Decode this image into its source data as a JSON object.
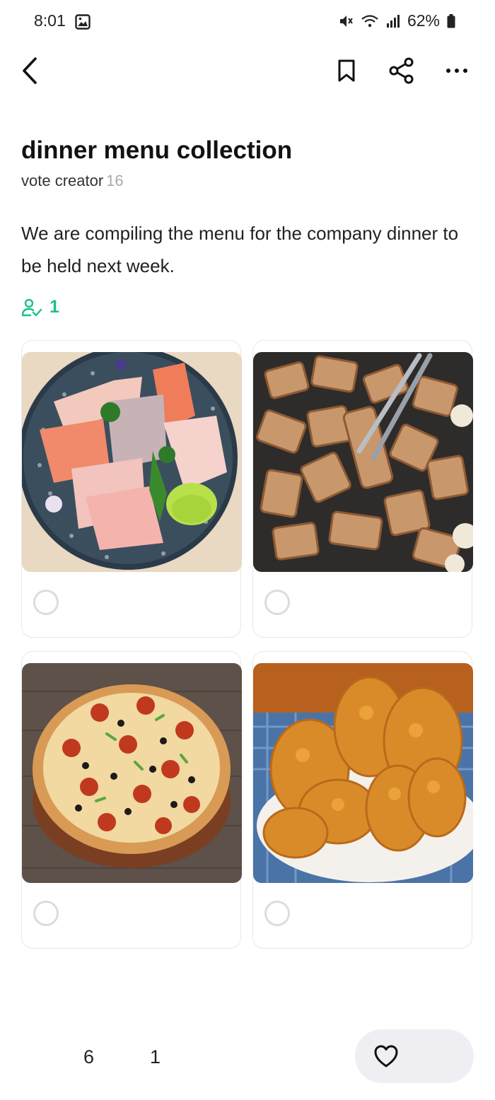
{
  "status_bar": {
    "time": "8:01",
    "battery": "62%",
    "icons": [
      "image-icon",
      "mute-icon",
      "wifi-icon",
      "signal-icon",
      "battery-icon"
    ]
  },
  "top_bar": {
    "icons": [
      "back-arrow-icon",
      "bookmark-icon",
      "share-icon",
      "more-icon"
    ]
  },
  "vote": {
    "title": "dinner menu collection",
    "creator_label": "vote creator",
    "creator_count": "16",
    "description": "We are compiling the menu for the company dinner to be held next week.",
    "voter_count": "1",
    "voter_icon": "voter-check-icon",
    "accent_color": "#17c28a"
  },
  "options": [
    {
      "image": "sashimi-platter-photo",
      "selected": false
    },
    {
      "image": "grilled-pork-belly-photo",
      "selected": false
    },
    {
      "image": "pizza-photo",
      "selected": false
    },
    {
      "image": "fried-chicken-photo",
      "selected": false
    }
  ],
  "bottom_bar": {
    "views": "6",
    "comments": "1",
    "like_icon": "heart-icon"
  }
}
